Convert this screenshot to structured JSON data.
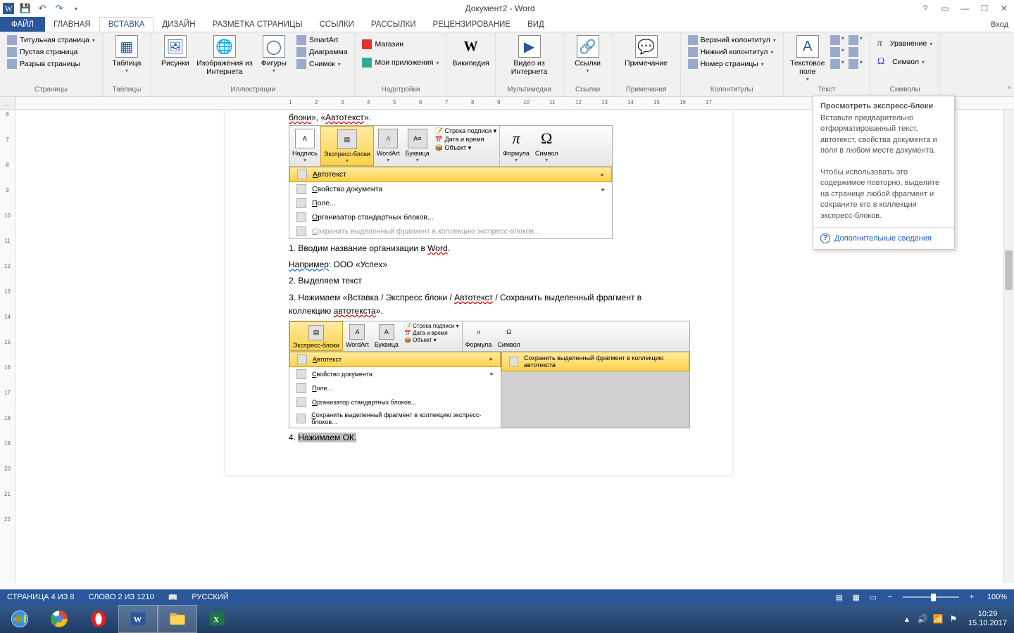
{
  "titlebar": {
    "title": "Документ2 - Word"
  },
  "tabs": {
    "file": "ФАЙЛ",
    "items": [
      "ГЛАВНАЯ",
      "ВСТАВКА",
      "ДИЗАЙН",
      "РАЗМЕТКА СТРАНИЦЫ",
      "ССЫЛКИ",
      "РАССЫЛКИ",
      "РЕЦЕНЗИРОВАНИЕ",
      "ВИД"
    ],
    "active_index": 1,
    "right": "Вход"
  },
  "ribbon": {
    "groups": {
      "pages": {
        "label": "Страницы",
        "items": [
          "Титульная страница",
          "Пустая страница",
          "Разрыв страницы"
        ]
      },
      "tables": {
        "label": "Таблицы",
        "btn": "Таблица"
      },
      "illustrations": {
        "label": "Иллюстрации",
        "pics": "Рисунки",
        "online": "Изображения из Интернета",
        "shapes": "Фигуры",
        "smartart": "SmartArt",
        "chart": "Диаграмма",
        "screenshot": "Снимок"
      },
      "addins": {
        "label": "Надстройки",
        "store": "Магазин",
        "myapps": "Мои приложения"
      },
      "wiki": {
        "btn": "Википедия"
      },
      "media": {
        "label": "Мультимедиа",
        "btn": "Видео из Интернета"
      },
      "links": {
        "label": "Ссылки",
        "btn": "Ссылки"
      },
      "comments": {
        "label": "Примечания",
        "btn": "Примечание"
      },
      "headers": {
        "label": "Колонтитулы",
        "top": "Верхний колонтитул",
        "bot": "Нижний колонтитул",
        "num": "Номер страницы"
      },
      "text": {
        "label": "Текст",
        "btn": "Текстовое поле"
      },
      "text_small": {
        "items": [
          "A",
          "A",
          "A",
          "A",
          "A",
          "A"
        ]
      },
      "symbols": {
        "label": "Символы",
        "eq": "Уравнение",
        "sym": "Символ"
      }
    }
  },
  "tooltip": {
    "title": "Просмотреть экспресс-блоки",
    "p1": "Вставьте предварительно отформатированный текст, автотекст, свойства документа и поля в любом месте документа.",
    "p2": "Чтобы использовать это содержимое повторно, выделите на странице любой фрагмент и сохраните его в коллекции экспресс-блоков.",
    "link": "Дополнительные сведения"
  },
  "embedded1": {
    "btns": {
      "nadpis": "Надпись",
      "express": "Экспресс-блоки",
      "wordart": "WordArt",
      "bukvitsa": "Буквица",
      "formula": "Формула",
      "symbol": "Символ"
    },
    "side": {
      "sigline": "Строка подписи",
      "datetime": "Дата и время",
      "object": "Объект"
    },
    "menu": [
      {
        "label": "Автотекст",
        "arrow": true,
        "hover": true
      },
      {
        "label": "Свойство документа",
        "arrow": true
      },
      {
        "label": "Поле..."
      },
      {
        "label": "Организатор стандартных блоков..."
      },
      {
        "label": "Сохранить выделенный фрагмент в коллекцию экспресс-блоков...",
        "disabled": true
      }
    ]
  },
  "doc": {
    "line1_a": "1. Вводим название организации в ",
    "line1_b": "Word",
    "line1_c": ".",
    "line2_a": "Например",
    "line2_b": ": ООО «Успех»",
    "line3": "2. Выделяем текст",
    "line4_a": "3. Нажимаем «Вставка / Экспресс блоки / ",
    "line4_b": "Автотекст",
    "line4_c": " / Сохранить выделенный фрагмент в коллекцию ",
    "line4_d": "автотекста",
    "line4_e": "».",
    "line5_a": "4. ",
    "line5_b": "Нажимаем ОК."
  },
  "embedded2": {
    "btns": {
      "express": "Экспресс-блоки",
      "wordart": "WordArt",
      "bukvitsa": "Буквица",
      "formula": "Формула",
      "symbol": "Символ"
    },
    "side": {
      "sigline": "Строка подписи",
      "datetime": "Дата и время",
      "object": "Объект"
    },
    "menu": [
      {
        "label": "Автотекст",
        "arrow": true,
        "hover": true
      },
      {
        "label": "Свойство документа",
        "arrow": true
      },
      {
        "label": "Поле..."
      },
      {
        "label": "Организатор стандартных блоков..."
      },
      {
        "label": "Сохранить выделенный фрагмент в коллекцию экспресс-блоков..."
      }
    ],
    "submenu": "Сохранить выделенный фрагмент в коллекцию автотекста"
  },
  "status": {
    "page": "СТРАНИЦА 4 ИЗ 8",
    "words": "СЛОВО 2 ИЗ 1210",
    "lang": "РУССКИЙ",
    "zoom": "100%"
  },
  "tray": {
    "time": "10:29",
    "date": "15.10.2017"
  },
  "ruler_h": [
    1,
    2,
    3,
    4,
    5,
    6,
    7,
    8,
    9,
    10,
    11,
    12,
    13,
    14,
    15,
    16,
    17
  ],
  "ruler_v": [
    6,
    7,
    8,
    9,
    10,
    11,
    12,
    13,
    14,
    15,
    16,
    17,
    18,
    19,
    20,
    21,
    22
  ]
}
